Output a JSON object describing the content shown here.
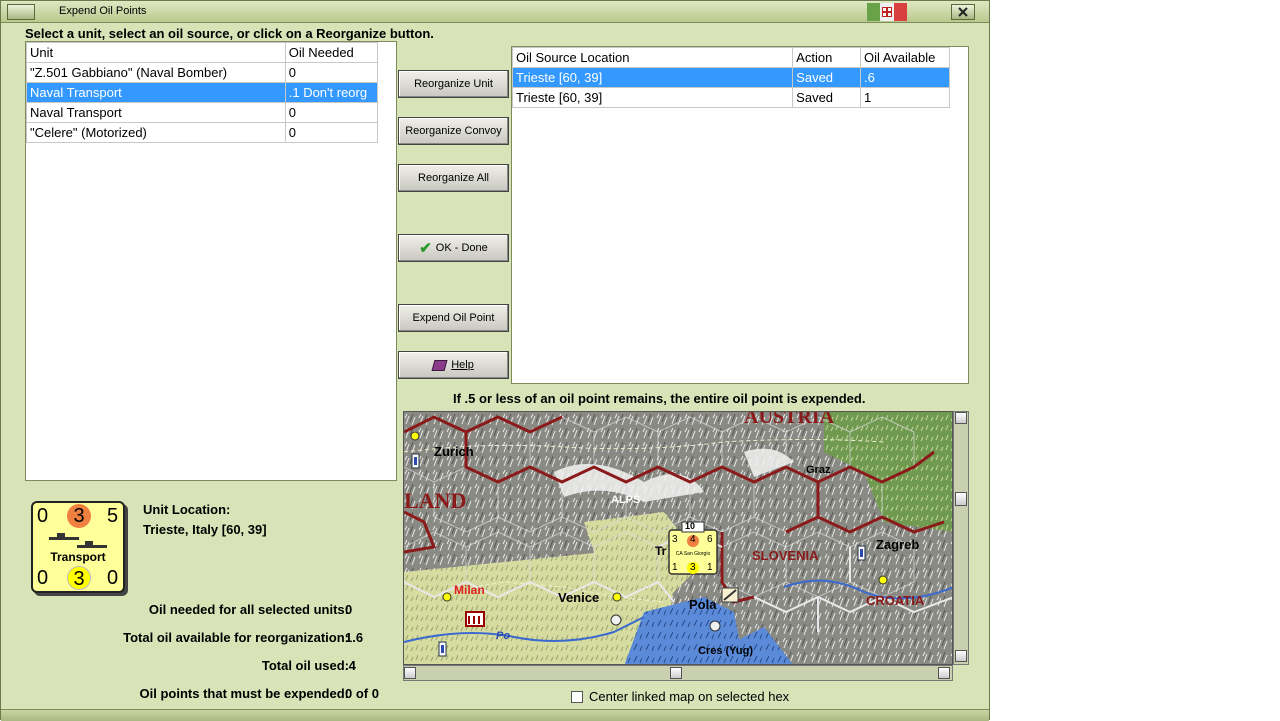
{
  "window": {
    "title": "Expend Oil Points",
    "instruction": "Select a unit, select an oil source, or click on a Reorganize button."
  },
  "unit_table": {
    "headers": [
      "Unit",
      "Oil Needed"
    ],
    "rows": [
      {
        "unit": "\"Z.501 Gabbiano\" (Naval Bomber)",
        "oil": "0"
      },
      {
        "unit": "Naval Transport",
        "oil": ".1 Don't reorg"
      },
      {
        "unit": "Naval Transport",
        "oil": "0"
      },
      {
        "unit": "\"Celere\" (Motorized)",
        "oil": "0"
      }
    ]
  },
  "buttons": {
    "reorganize_unit": "Reorganize Unit",
    "reorganize_convoy": "Reorganize Convoy",
    "reorganize_all": "Reorganize All",
    "ok_done": "OK - Done",
    "expend_oil_point": "Expend Oil Point",
    "help": "Help"
  },
  "source_table": {
    "headers": [
      "Oil Source Location",
      "Action",
      "Oil Available"
    ],
    "rows": [
      {
        "location": "Trieste [60, 39]",
        "action": "Saved",
        "available": ".6"
      },
      {
        "location": "Trieste [60, 39]",
        "action": "Saved",
        "available": "1"
      }
    ]
  },
  "note": "If .5 or less of an oil point remains, the entire oil point is expended.",
  "counter": {
    "top_left": "0",
    "top_mid": "3",
    "top_right": "5",
    "label": "Transport",
    "bottom_left": "0",
    "bottom_mid": "3",
    "bottom_right": "0"
  },
  "unit_location": {
    "label": "Unit Location:",
    "value": "Trieste, Italy [60, 39]"
  },
  "stats": [
    {
      "label": "Oil needed for all selected units:",
      "value": "0"
    },
    {
      "label": "Total oil available for reorganization:",
      "value": "1.6"
    },
    {
      "label": "Total oil used:",
      "value": ".4"
    },
    {
      "label": "Oil points that must be expended:",
      "value": "0 of 0"
    }
  ],
  "map": {
    "labels": {
      "austria": "AUSTRIA",
      "zurich": "Zurich",
      "land": "LAND",
      "alps": "ALPS",
      "graz": "Graz",
      "slovenia": "SLOVENIA",
      "zagreb": "Zagreb",
      "croatia": "CROATIA",
      "milan": "Milan",
      "venice": "Venice",
      "pola": "Pola",
      "po": "Po",
      "cres": "Cres (Yug)",
      "trieste_partial": "Tr"
    },
    "map_counter": {
      "top": "10",
      "tl": "3",
      "tm": "4",
      "tr": "6",
      "name": "CA San Giorgio",
      "bl": "1",
      "bm": "3",
      "br": "1"
    }
  },
  "center_map_label": "Center linked map on selected hex",
  "colors": {
    "window_bg": "#d8e4b8",
    "selection": "#3399ff",
    "border_red": "#8b1a1a"
  }
}
